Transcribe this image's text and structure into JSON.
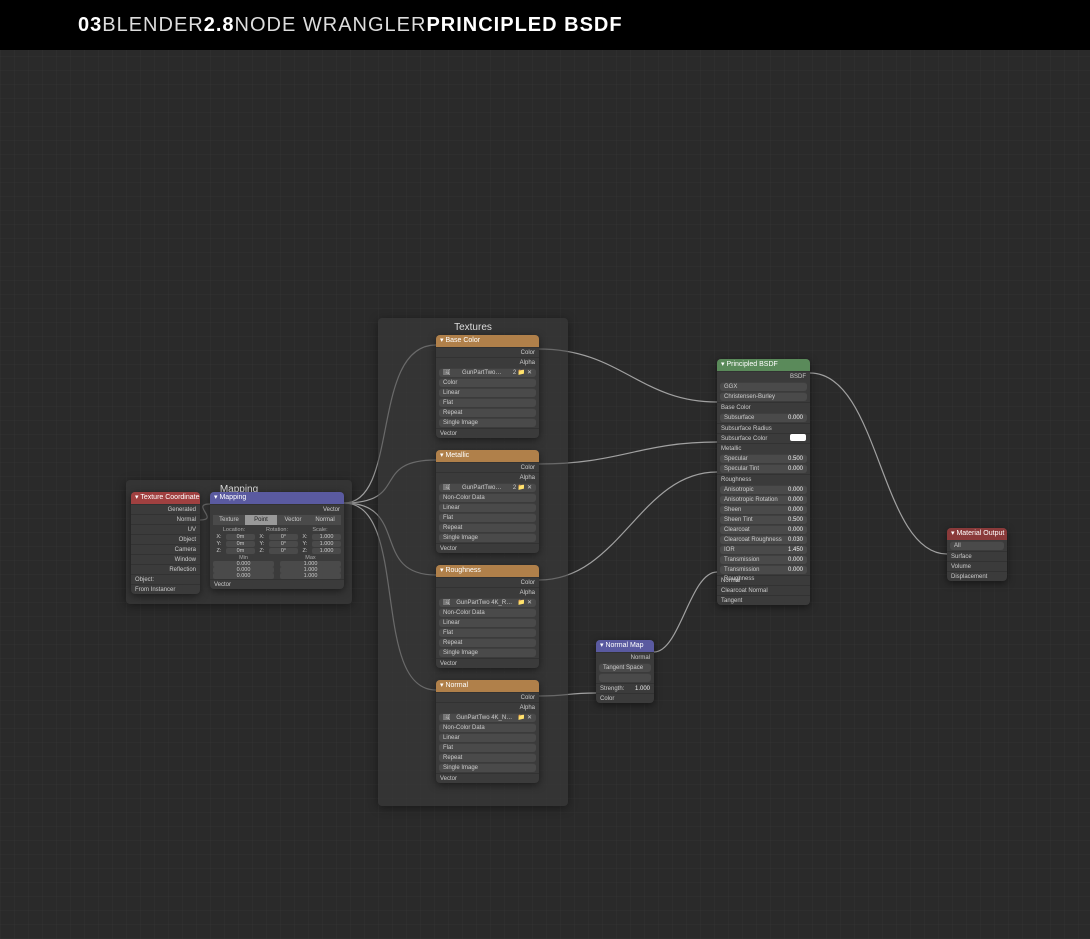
{
  "banner": {
    "t1": "03",
    "t2": " BLENDER ",
    "t3": "2.8",
    "t4": " NODE WRANGLER ",
    "t5": "PRINCIPLED BSDF"
  },
  "frames": {
    "mapping": {
      "label": "Mapping"
    },
    "textures": {
      "label": "Textures"
    }
  },
  "texcoord": {
    "title": "▾ Texture Coordinate",
    "outs": [
      "Generated",
      "Normal",
      "UV",
      "Object",
      "Camera",
      "Window",
      "Reflection"
    ],
    "obj_label": "Object:",
    "from_inst": "From Instancer"
  },
  "mapping": {
    "title": "▾ Mapping",
    "out": "Vector",
    "tabs": [
      "Texture",
      "Point",
      "Vector",
      "Normal"
    ],
    "col_headers": [
      "Location:",
      "Rotation:",
      "Scale:"
    ],
    "axes": [
      "X:",
      "Y:",
      "Z:"
    ],
    "loc": [
      "0m",
      "0m",
      "0m"
    ],
    "rot": [
      "0°",
      "0°",
      "0°"
    ],
    "scl": [
      "1.000",
      "1.000",
      "1.000"
    ],
    "min_label": "Min",
    "max_label": "Max",
    "min": [
      "0.000",
      "0.000",
      "0.000"
    ],
    "max": [
      "1.000",
      "1.000",
      "1.000"
    ],
    "vec_in": "Vector"
  },
  "tex": {
    "basecolor": {
      "title": "▾ Base Color",
      "outs": [
        "Color",
        "Alpha"
      ],
      "img": "GunPartTwo…",
      "cs": "Color",
      "params": [
        "Linear",
        "Flat",
        "Repeat",
        "Single Image"
      ],
      "vec": "Vector"
    },
    "metallic": {
      "title": "▾ Metallic",
      "outs": [
        "Color",
        "Alpha"
      ],
      "img": "GunPartTwo…",
      "cs": "Non-Color Data",
      "params": [
        "Linear",
        "Flat",
        "Repeat",
        "Single Image"
      ],
      "vec": "Vector"
    },
    "roughness": {
      "title": "▾ Roughness",
      "outs": [
        "Color",
        "Alpha"
      ],
      "img": "GunPartTwo 4K_R…",
      "cs": "Non-Color Data",
      "params": [
        "Linear",
        "Flat",
        "Repeat",
        "Single Image"
      ],
      "vec": "Vector"
    },
    "normal": {
      "title": "▾ Normal",
      "outs": [
        "Color",
        "Alpha"
      ],
      "img": "GunPartTwo 4K_N…",
      "cs": "Non-Color Data",
      "params": [
        "Linear",
        "Flat",
        "Repeat",
        "Single Image"
      ],
      "vec": "Vector"
    }
  },
  "normalmap": {
    "title": "▾ Normal Map",
    "out": "Normal",
    "space": "Tangent Space",
    "strength_label": "Strength:",
    "strength": "1.000",
    "in": "Color"
  },
  "bsdf": {
    "title": "▾ Principled BSDF",
    "out": "BSDF",
    "dist": "GGX",
    "sss": "Christensen-Burley",
    "rows": [
      {
        "l": "Base Color",
        "v": ""
      },
      {
        "l": "Subsurface",
        "v": "0.000"
      },
      {
        "l": "Subsurface Radius",
        "v": ""
      },
      {
        "l": "Subsurface Color",
        "v": "",
        "swatch": true
      },
      {
        "l": "Metallic",
        "v": ""
      },
      {
        "l": "Specular",
        "v": "0.500"
      },
      {
        "l": "Specular Tint",
        "v": "0.000"
      },
      {
        "l": "Roughness",
        "v": ""
      },
      {
        "l": "Anisotropic",
        "v": "0.000"
      },
      {
        "l": "Anisotropic Rotation",
        "v": "0.000"
      },
      {
        "l": "Sheen",
        "v": "0.000"
      },
      {
        "l": "Sheen Tint",
        "v": "0.500"
      },
      {
        "l": "Clearcoat",
        "v": "0.000"
      },
      {
        "l": "Clearcoat Roughness",
        "v": "0.030"
      },
      {
        "l": "IOR",
        "v": "1.450"
      },
      {
        "l": "Transmission",
        "v": "0.000"
      },
      {
        "l": "Transmission Roughness",
        "v": "0.000"
      },
      {
        "l": "Normal",
        "v": ""
      },
      {
        "l": "Clearcoat Normal",
        "v": ""
      },
      {
        "l": "Tangent",
        "v": ""
      }
    ]
  },
  "matout": {
    "title": "▾ Material Output",
    "target": "All",
    "ins": [
      "Surface",
      "Volume",
      "Displacement"
    ]
  }
}
